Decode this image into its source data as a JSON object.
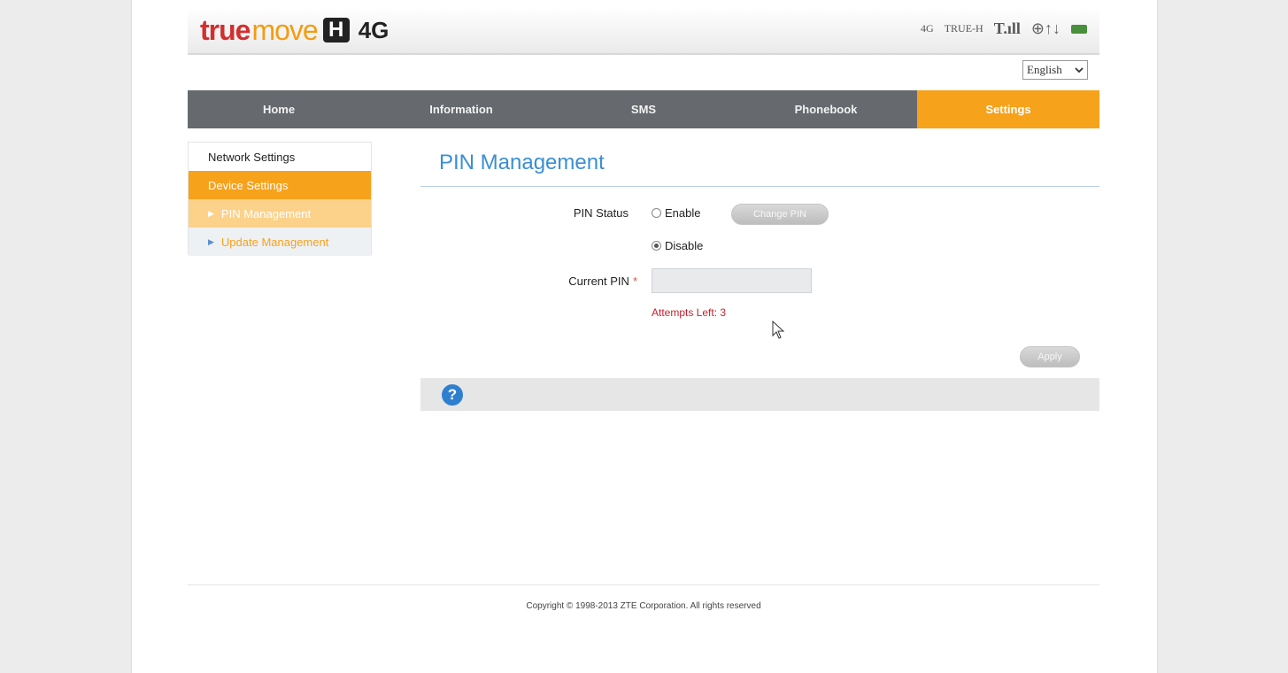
{
  "header": {
    "logo_true": "true",
    "logo_move": "move",
    "logo_h": "H",
    "logo_4g": "4G",
    "status_network_type": "4G",
    "status_operator": "TRUE-H",
    "status_signal": "T.ıll",
    "status_data": "⊕↑↓"
  },
  "language": {
    "selected": "English"
  },
  "nav": {
    "tabs": [
      {
        "label": "Home"
      },
      {
        "label": "Information"
      },
      {
        "label": "SMS"
      },
      {
        "label": "Phonebook"
      },
      {
        "label": "Settings"
      }
    ],
    "active": "Settings"
  },
  "sidebar": {
    "items": [
      {
        "label": "Network Settings"
      },
      {
        "label": "Device Settings"
      },
      {
        "label": "PIN Management"
      },
      {
        "label": "Update Management"
      }
    ]
  },
  "main": {
    "title": "PIN Management",
    "pin_status_label": "PIN Status",
    "enable_label": "Enable",
    "disable_label": "Disable",
    "selected": "Disable",
    "change_pin_label": "Change PIN",
    "current_pin_label": "Current PIN",
    "required_mark": "*",
    "current_pin_value": "",
    "attempts_left": "Attempts Left: 3",
    "apply_label": "Apply"
  },
  "footer": {
    "copyright": "Copyright © 1998-2013 ZTE Corporation. All rights reserved"
  },
  "colors": {
    "accent": "#f7a21b",
    "nav_bg": "#666a6e",
    "title": "#3a8fd4",
    "error": "#c8202e"
  },
  "icons": [
    "signal-icon",
    "globe-icon",
    "sim-icon",
    "chevron-down-icon",
    "help-icon",
    "cursor-icon"
  ]
}
